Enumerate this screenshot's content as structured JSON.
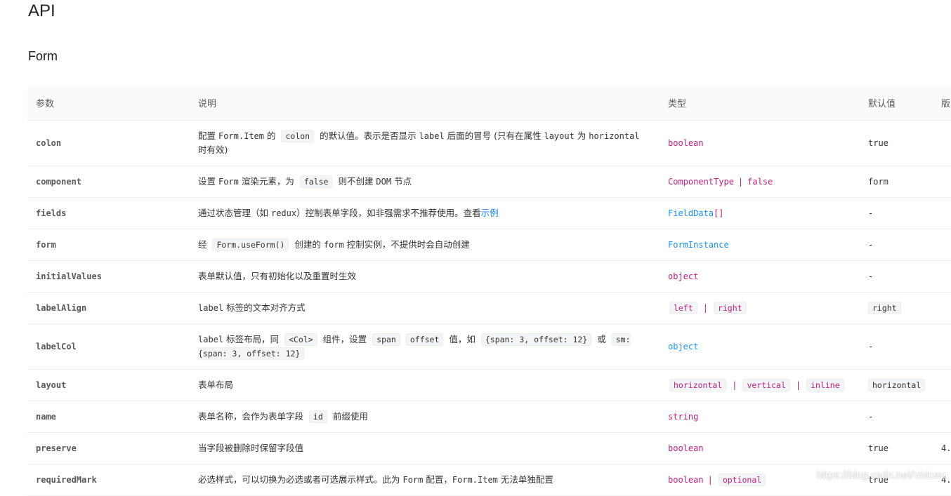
{
  "page": {
    "title": "API",
    "section": "Form"
  },
  "table": {
    "headers": [
      "参数",
      "说明",
      "类型",
      "默认值",
      "版本"
    ],
    "rows": {
      "colon": {
        "param": "colon",
        "desc": [
          "配置 ",
          "Form.Item",
          " 的 ",
          "colon",
          " 的默认值。表示是否显示 ",
          "label",
          " 后面的冒号 (只有在属性 ",
          "layout",
          " 为 ",
          "horizontal",
          " 时有效)"
        ],
        "type": "boolean",
        "default": "true"
      },
      "component": {
        "param": "component",
        "desc": [
          "设置 ",
          "Form",
          " 渲染元素，为 ",
          "false",
          " 则不创建 ",
          "DOM",
          " 节点"
        ],
        "type": [
          "ComponentType",
          "|",
          "false"
        ],
        "default": "form"
      },
      "fields": {
        "param": "fields",
        "desc": [
          "通过状态管理（如 ",
          "redux",
          "）控制表单字段，如非强需求不推荐使用。查看",
          "示例"
        ],
        "type": [
          "FieldData",
          "[]"
        ],
        "default": "-"
      },
      "form": {
        "param": "form",
        "desc": [
          "经 ",
          "Form.useForm()",
          " 创建的 ",
          "form",
          " 控制实例，不提供时会自动创建"
        ],
        "type": "FormInstance",
        "default": "-"
      },
      "initialValues": {
        "param": "initialValues",
        "desc": "表单默认值，只有初始化以及重置时生效",
        "type": "object",
        "default": "-"
      },
      "labelAlign": {
        "param": "labelAlign",
        "desc": [
          "label",
          " 标签的文本对齐方式"
        ],
        "type": [
          "left",
          "|",
          "right"
        ],
        "default": "right"
      },
      "labelCol": {
        "param": "labelCol",
        "desc": [
          "label",
          " 标签布局，同 ",
          "<Col>",
          " 组件，设置 ",
          "span",
          "offset",
          " 值，如 ",
          "{span: 3, offset: 12}",
          " 或 ",
          "sm: {span: 3, offset: 12}"
        ],
        "type": "object",
        "default": "-"
      },
      "layout": {
        "param": "layout",
        "desc": "表单布局",
        "type": [
          "horizontal",
          "|",
          "vertical",
          "|",
          "inline"
        ],
        "default": "horizontal"
      },
      "name": {
        "param": "name",
        "desc": [
          "表单名称，会作为表单字段 ",
          "id",
          " 前缀使用"
        ],
        "type": "string",
        "default": "-"
      },
      "preserve": {
        "param": "preserve",
        "desc": "当字段被删除时保留字段值",
        "type": "boolean",
        "default": "true",
        "version": "4."
      },
      "requiredMark": {
        "param": "requiredMark",
        "desc": [
          "必选样式，可以切换为必选或者可选展示样式。此为 ",
          "Form",
          " 配置，",
          "Form.Item",
          " 无法单独配置"
        ],
        "type": [
          "boolean",
          "|",
          "optional"
        ],
        "default": "true",
        "version": "4."
      }
    }
  },
  "watermark": "https://blog.csdn.net/Volceu",
  "colors": {
    "type_string": "#c41d7f",
    "type_link": "#1890ff",
    "header_bg": "#fafafa",
    "chip_bg": "#f2f4f5"
  }
}
